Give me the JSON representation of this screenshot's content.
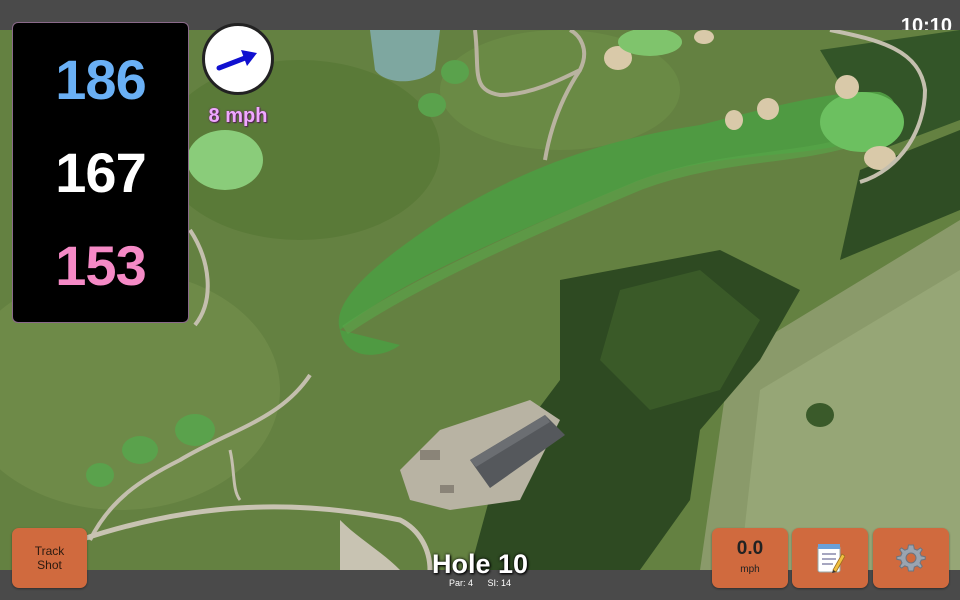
{
  "status_bar": {
    "time": "10:10"
  },
  "distances": {
    "back": "186",
    "middle": "167",
    "front": "153"
  },
  "wind": {
    "speed": "8 mph",
    "direction_icon": "wind-arrow-icon"
  },
  "hole": {
    "title": "Hole 10",
    "par": "Par: 4",
    "stroke_index": "SI: 14"
  },
  "buttons": {
    "track_shot_line1": "Track",
    "track_shot_line2": "Shot",
    "speed_value": "0.0",
    "speed_unit": "mph",
    "notes_icon": "notepad-icon",
    "settings_icon": "gear-icon"
  },
  "colors": {
    "back_distance": "#6ab0f5",
    "middle_distance": "#ffffff",
    "front_distance": "#f58ac6",
    "button_accent": "#d06a3e",
    "wind_text": "#f0a8ff"
  }
}
